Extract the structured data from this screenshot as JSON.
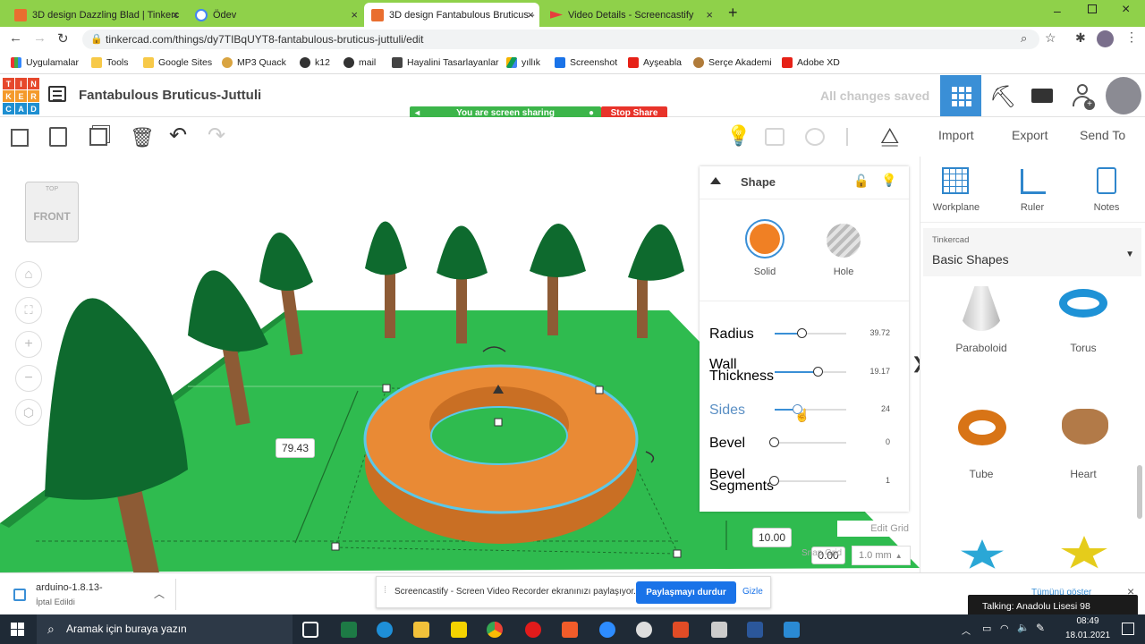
{
  "browser": {
    "tabs": [
      {
        "title": "3D design Dazzling Blad | Tinkerc",
        "active": false
      },
      {
        "title": "Ödev",
        "active": false
      },
      {
        "title": "3D design Fantabulous Bruticus -",
        "active": true
      },
      {
        "title": "Video Details - Screencastify",
        "active": false
      }
    ],
    "new_tab_label": "+",
    "url": "tinkercad.com/things/dy7TIBqUYT8-fantabulous-bruticus-juttuli/edit",
    "bookmarks": [
      "Uygulamalar",
      "Tools",
      "Google Sites",
      "MP3 Quack",
      "k12",
      "mail",
      "Hayalini Tasarlayanlar",
      "yıllık",
      "Screenshot",
      "Ayşeabla",
      "Serçe Akademi",
      "Adobe XD"
    ]
  },
  "app": {
    "logo_letters": [
      "T",
      "I",
      "N",
      "K",
      "E",
      "R",
      "C",
      "A",
      "D"
    ],
    "design_title": "Fantabulous Bruticus-Juttuli",
    "save_status": "All changes saved",
    "screen_sharing": "You are screen sharing",
    "stop_share": "Stop Share",
    "toolbar_right": {
      "import": "Import",
      "export": "Export",
      "send_to": "Send To"
    }
  },
  "viewcube": {
    "top": "TOP",
    "front": "FRONT"
  },
  "viewport": {
    "dimension_radius": "79.43",
    "dimension_height": "10.00",
    "dimension_small": "0.00",
    "edit_grid": "Edit Grid",
    "snap_grid_label": "Snap Grid",
    "snap_value": "1.0 mm"
  },
  "shape_panel": {
    "title": "Shape",
    "solid": "Solid",
    "hole": "Hole",
    "params": [
      {
        "label": "Radius",
        "value": "39.72",
        "fraction": 0.4
      },
      {
        "label": "Wall\nThickness",
        "value": "19.17",
        "fraction": 0.6
      },
      {
        "label": "Sides",
        "value": "24",
        "fraction": 0.3
      },
      {
        "label": "Bevel",
        "value": "0",
        "fraction": 0.0
      },
      {
        "label": "Bevel\nSegments",
        "value": "1",
        "fraction": 0.0
      }
    ]
  },
  "right_panel": {
    "workplane": "Workplane",
    "ruler": "Ruler",
    "notes": "Notes",
    "library_source": "Tinkercad",
    "library_name": "Basic Shapes",
    "shapes": [
      "Paraboloid",
      "Torus",
      "Tube",
      "Heart"
    ]
  },
  "download_bar": {
    "filename": "arduino-1.8.13-",
    "status": "İptal Edildi"
  },
  "screencastify": {
    "message": "Screencastify - Screen Video Recorder ekranınızı paylaşıyor.",
    "stop_button": "Paylaşmayı durdur",
    "hide": "Gizle",
    "show_all": "Tümünü göster"
  },
  "taskbar": {
    "search_placeholder": "Aramak için buraya yazın",
    "time": "08:49",
    "date": "18.01.2021",
    "talking": "Talking: Anadolu Lisesi 98"
  },
  "colors": {
    "chrome_green": "#8fd14a",
    "accent_blue": "#3a8fd6",
    "torus_orange": "#e98a35",
    "grid_green": "#2fbb4f",
    "tree_green": "#0e6a2e"
  }
}
